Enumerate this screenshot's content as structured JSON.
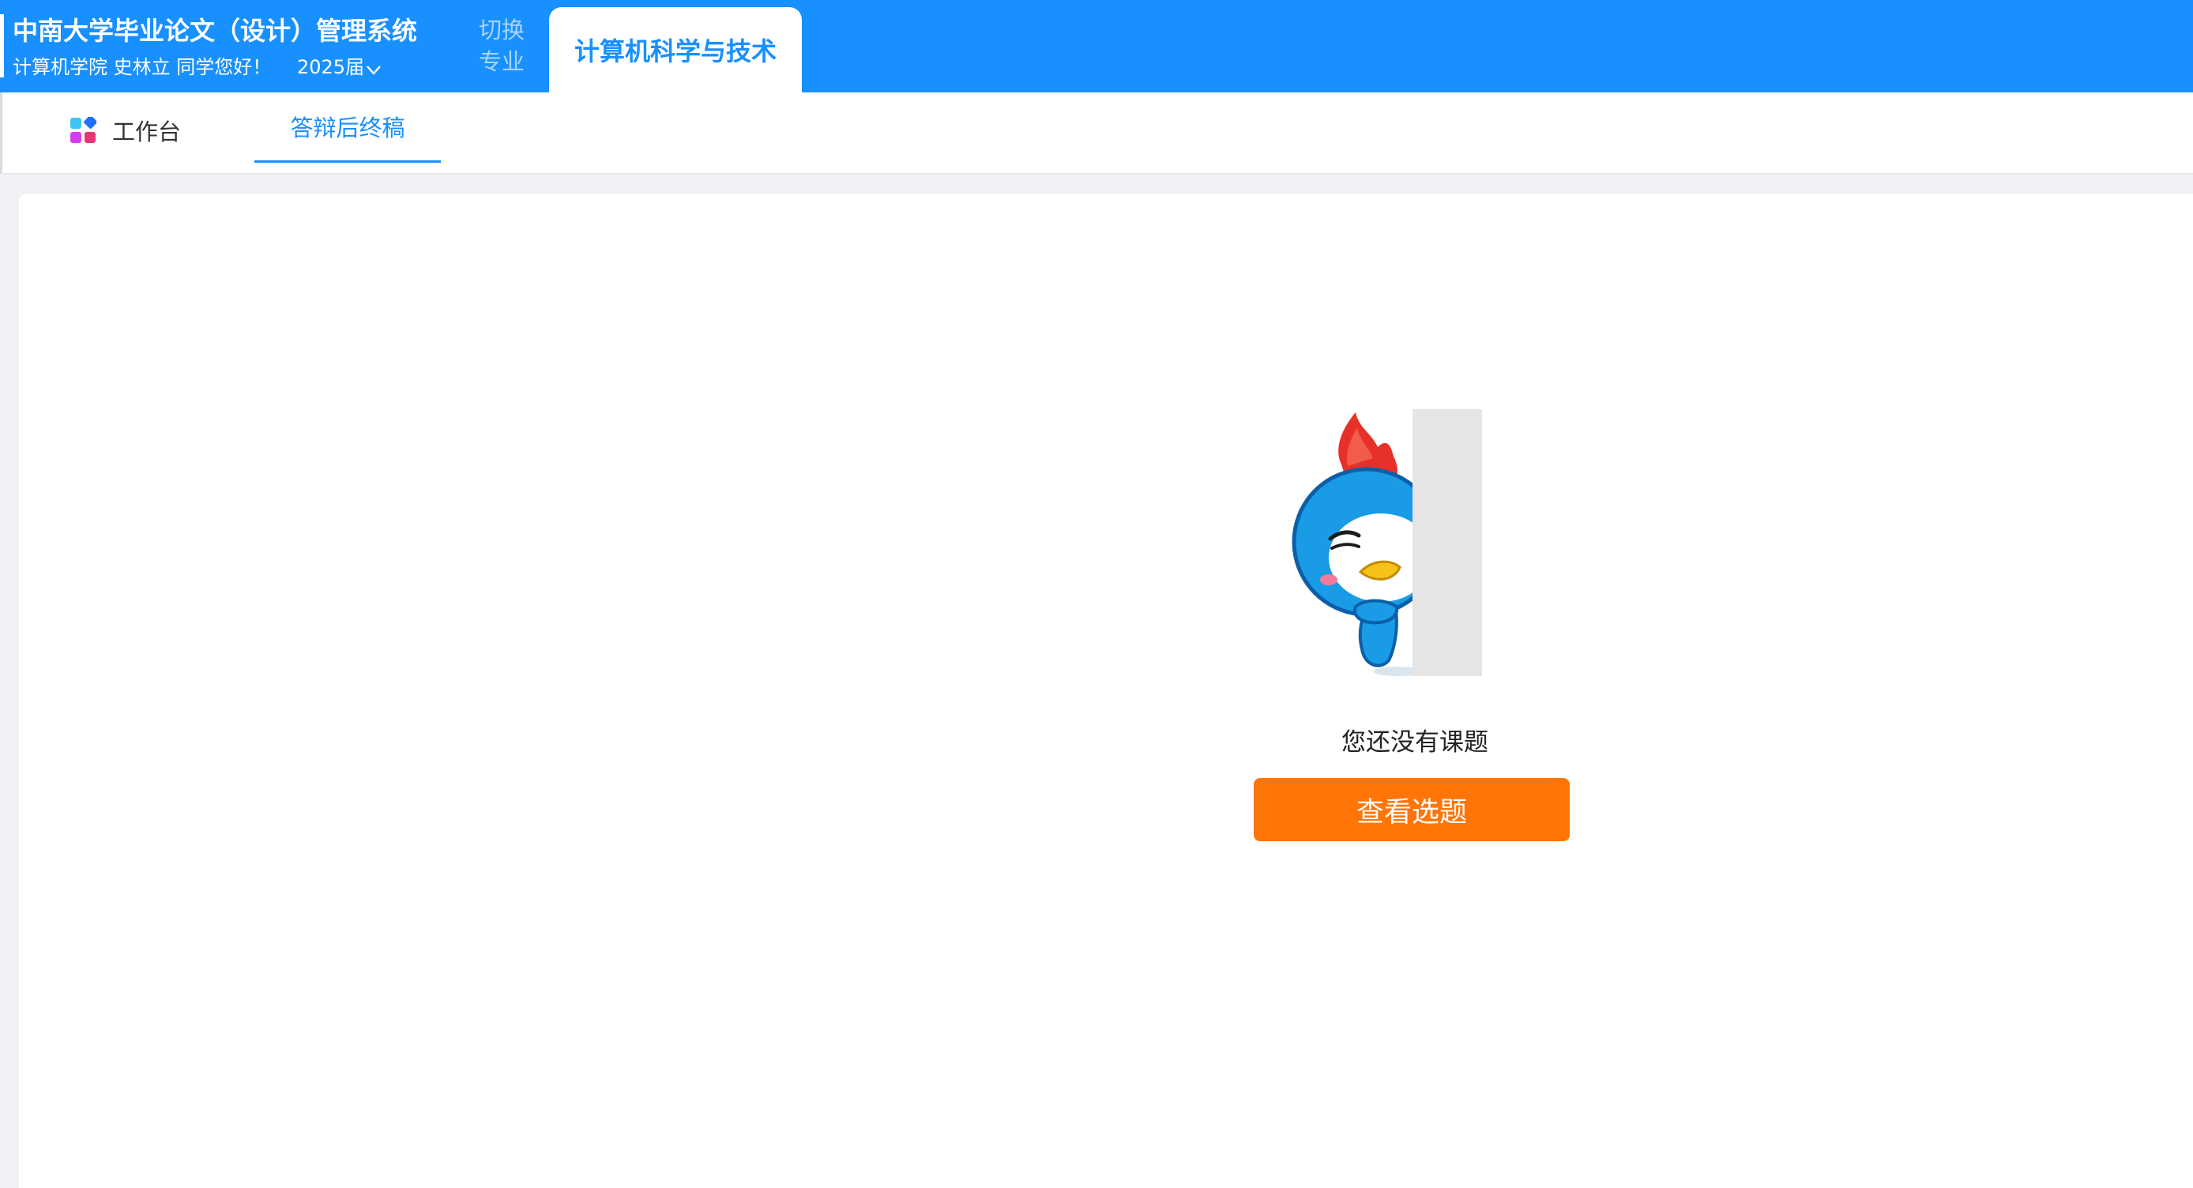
{
  "header": {
    "system_title": "中南大学毕业论文（设计）管理系统",
    "user_greeting": "计算机学院  史林立  同学您好！",
    "year_label": "2025届",
    "switch_major_line1": "切换",
    "switch_major_line2": "专业",
    "major_name": "计算机科学与技术",
    "brand_color": "#1890ff"
  },
  "tabs": {
    "workbench_label": "工作台",
    "workbench_icon": "apps-grid-icon",
    "active_label": "答辩后终稿"
  },
  "main": {
    "empty_message": "您还没有课题",
    "action_button_label": "查看选题",
    "action_button_color": "#ff7508",
    "illustration": "mascot-bird-peeking"
  }
}
